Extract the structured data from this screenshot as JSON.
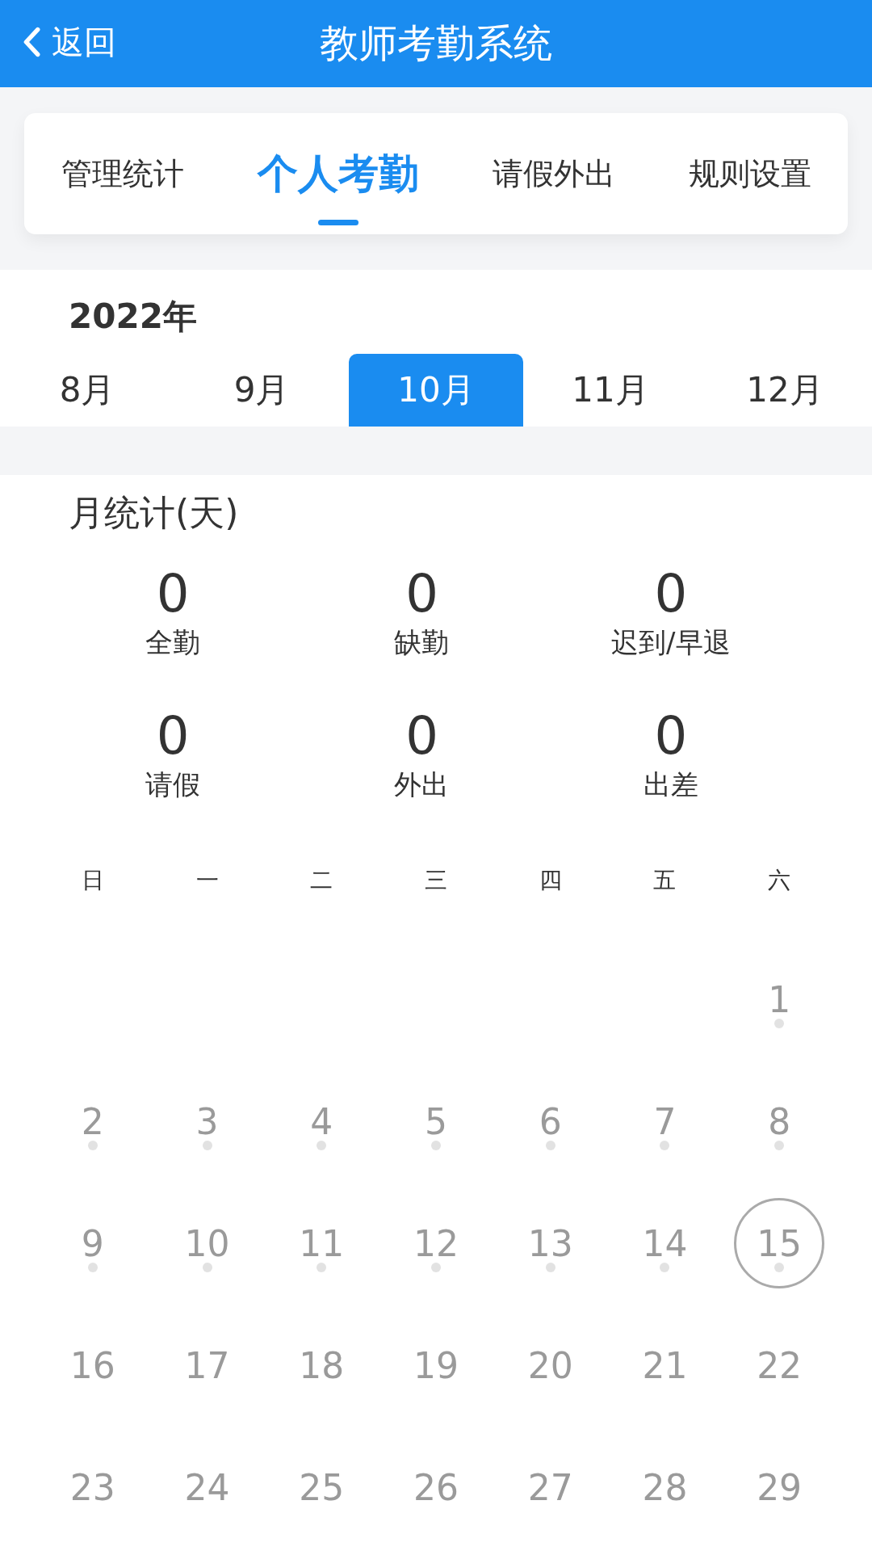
{
  "header": {
    "back_label": "返回",
    "title": "教师考勤系统"
  },
  "tabs": [
    {
      "label": "管理统计",
      "selected": false
    },
    {
      "label": "个人考勤",
      "selected": true
    },
    {
      "label": "请假外出",
      "selected": false
    },
    {
      "label": "规则设置",
      "selected": false
    }
  ],
  "year": "2022年",
  "months": [
    {
      "label": "8月",
      "selected": false
    },
    {
      "label": "9月",
      "selected": false
    },
    {
      "label": "10月",
      "selected": true
    },
    {
      "label": "11月",
      "selected": false
    },
    {
      "label": "12月",
      "selected": false
    }
  ],
  "stats": {
    "title": "月统计(天)",
    "items": [
      {
        "value": "0",
        "label": "全勤"
      },
      {
        "value": "0",
        "label": "缺勤"
      },
      {
        "value": "0",
        "label": "迟到/早退"
      },
      {
        "value": "0",
        "label": "请假"
      },
      {
        "value": "0",
        "label": "外出"
      },
      {
        "value": "0",
        "label": "出差"
      }
    ]
  },
  "calendar": {
    "weekdays": [
      "日",
      "一",
      "二",
      "三",
      "四",
      "五",
      "六"
    ],
    "weeks": [
      {
        "align_end": true,
        "days": [
          {
            "day": "1",
            "dot": true,
            "selected": false
          }
        ]
      },
      {
        "days": [
          {
            "day": "2",
            "dot": true,
            "selected": false
          },
          {
            "day": "3",
            "dot": true,
            "selected": false
          },
          {
            "day": "4",
            "dot": true,
            "selected": false
          },
          {
            "day": "5",
            "dot": true,
            "selected": false
          },
          {
            "day": "6",
            "dot": true,
            "selected": false
          },
          {
            "day": "7",
            "dot": true,
            "selected": false
          },
          {
            "day": "8",
            "dot": true,
            "selected": false
          }
        ]
      },
      {
        "days": [
          {
            "day": "9",
            "dot": true,
            "selected": false
          },
          {
            "day": "10",
            "dot": true,
            "selected": false
          },
          {
            "day": "11",
            "dot": true,
            "selected": false
          },
          {
            "day": "12",
            "dot": true,
            "selected": false
          },
          {
            "day": "13",
            "dot": true,
            "selected": false
          },
          {
            "day": "14",
            "dot": true,
            "selected": false
          },
          {
            "day": "15",
            "dot": true,
            "selected": true
          }
        ]
      },
      {
        "days": [
          {
            "day": "16",
            "dot": false,
            "selected": false
          },
          {
            "day": "17",
            "dot": false,
            "selected": false
          },
          {
            "day": "18",
            "dot": false,
            "selected": false
          },
          {
            "day": "19",
            "dot": false,
            "selected": false
          },
          {
            "day": "20",
            "dot": false,
            "selected": false
          },
          {
            "day": "21",
            "dot": false,
            "selected": false
          },
          {
            "day": "22",
            "dot": false,
            "selected": false
          }
        ]
      },
      {
        "days": [
          {
            "day": "23",
            "dot": false,
            "selected": false
          },
          {
            "day": "24",
            "dot": false,
            "selected": false
          },
          {
            "day": "25",
            "dot": false,
            "selected": false
          },
          {
            "day": "26",
            "dot": false,
            "selected": false
          },
          {
            "day": "27",
            "dot": false,
            "selected": false
          },
          {
            "day": "28",
            "dot": false,
            "selected": false
          },
          {
            "day": "29",
            "dot": false,
            "selected": false
          }
        ]
      }
    ]
  }
}
